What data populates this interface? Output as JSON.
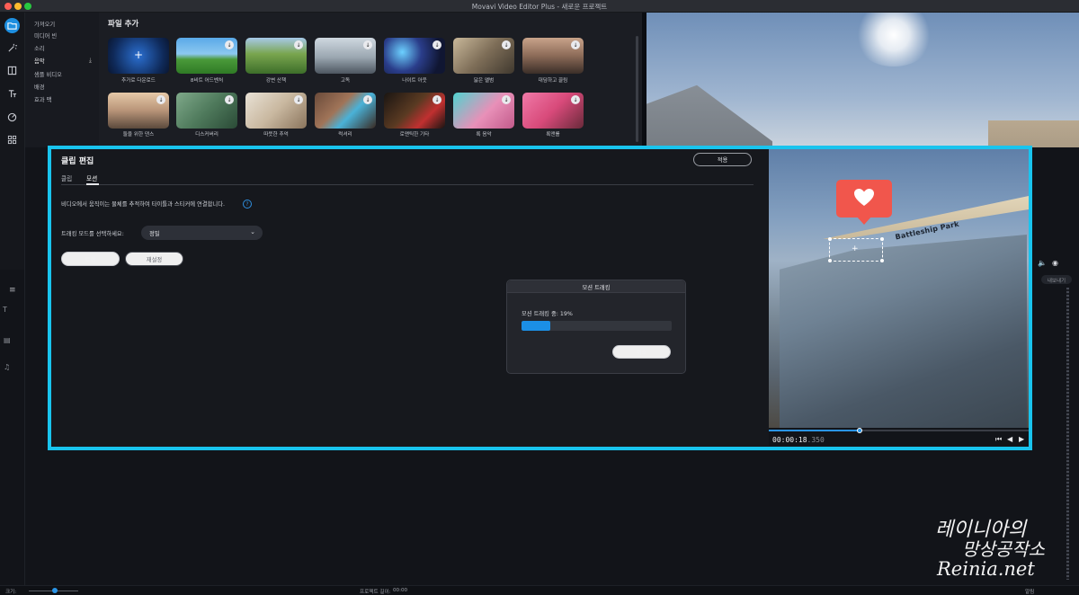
{
  "window": {
    "title": "Movavi Video Editor Plus - 새로운 프로젝트"
  },
  "categories": [
    {
      "label": "가져오기"
    },
    {
      "label": "미디어 빈"
    },
    {
      "label": "소리"
    },
    {
      "label": "음악",
      "active": true
    },
    {
      "label": "샘플 비디오"
    },
    {
      "label": "배경"
    },
    {
      "label": "효과 팩"
    }
  ],
  "media": {
    "title": "파일 추가",
    "items": [
      {
        "label": "추가로 다운로드",
        "plus": "+"
      },
      {
        "label": "8비트 어드벤처"
      },
      {
        "label": "강변 산책"
      },
      {
        "label": "고독"
      },
      {
        "label": "나이트 아웃"
      },
      {
        "label": "닳은 앨범"
      },
      {
        "label": "대담하고 끌림"
      },
      {
        "label": "둘을 위한 댄스"
      },
      {
        "label": "디스커버리"
      },
      {
        "label": "따뜻한 추억"
      },
      {
        "label": "럭셔리"
      },
      {
        "label": "로맨틱한 기타"
      },
      {
        "label": "록 음악"
      },
      {
        "label": "록앤롤"
      }
    ]
  },
  "clip_edit": {
    "title": "클립 편집",
    "apply_label": "적용",
    "tabs": [
      {
        "label": "클립"
      },
      {
        "label": "모션"
      }
    ],
    "description": "비디오에서 움직이는 물체를 추적하여 타이틀과 스티커에 연결합니다.",
    "help": "?",
    "mode_label": "트래킹 모드를 선택하세요:",
    "mode_value": "정밀",
    "track_label": "트랙",
    "reset_label": "재설정"
  },
  "progress_modal": {
    "title": "모션 트래킹",
    "status": "모션 트래킹 중: 19%",
    "progress": 0.19,
    "cancel_label": "취소"
  },
  "preview": {
    "timecode": "00:00:18",
    "timecode_ms": ".350",
    "sign_text": "Battleship Park"
  },
  "status_bar": {
    "zoom_label": "크기:",
    "project_length_label": "프로젝트 길이:",
    "project_length_value": "00:00",
    "notify_label": "알림"
  },
  "right_panel": {
    "export_label": "내보내기"
  },
  "watermark": {
    "line1": "레이니아의",
    "line2": "망상공작소",
    "line3": "Reinia.net"
  },
  "colors": {
    "accent": "#19c4ee",
    "progress": "#1b8fe6",
    "heart": "#f1564c"
  }
}
